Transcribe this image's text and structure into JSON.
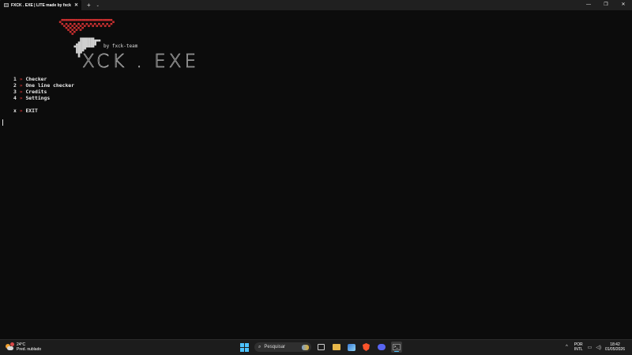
{
  "window": {
    "tab_title": "FXCK . EXE | LITE made by fxck",
    "tab_close": "✕",
    "new_tab": "+",
    "tab_dropdown": "⌄",
    "minimize": "—",
    "maximize": "❐",
    "close": "✕"
  },
  "terminal": {
    "logo_red": "     ▄▀▀▀▀▀▀▀▀▀▀▀▀▀▀▀▀▀▀▀▀▀▀▀▀▀▄\n      ▀▄▀▄▀▄▀▄▀▄▀▄▀▄▀▄▀▄▀▄▀▄▀▄▀\n        ▀▄▀▄▀▄▀▄▀\n          ▀▄▀",
    "logo_white": "         ▄▄▄▄▄▄▄\n        ▄████████▀▀\n      ▄█████████▀\n       ████▀\n       ▀█▀\n        ▀",
    "byline": "by fxck-team",
    "big_text": "XCK . EXE",
    "menu": [
      {
        "key": "1",
        "arrow": "»",
        "label": "Checker"
      },
      {
        "key": "2",
        "arrow": "»",
        "label": "One line checker"
      },
      {
        "key": "3",
        "arrow": "»",
        "label": "Credits"
      },
      {
        "key": "4",
        "arrow": "»",
        "label": "Settings"
      }
    ],
    "exit": {
      "key": "x",
      "arrow": "»",
      "label": "EXIT"
    }
  },
  "taskbar": {
    "weather_temp": "24°C",
    "weather_desc": "Pred. nublado",
    "search_placeholder": "Pesquisar",
    "search_icon": "search-icon",
    "lang_code": "POR",
    "lang_layout": "INTL",
    "time": "18:42",
    "date": "01/05/2026"
  }
}
